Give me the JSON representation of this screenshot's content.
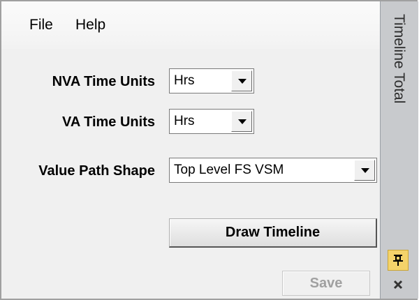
{
  "menu": {
    "file": "File",
    "help": "Help"
  },
  "form": {
    "nva_label": "NVA Time Units",
    "nva_value": "Hrs",
    "va_label": "VA Time Units",
    "va_value": "Hrs",
    "shape_label": "Value Path Shape",
    "shape_value": "Top Level FS VSM"
  },
  "buttons": {
    "draw": "Draw Timeline",
    "save": "Save"
  },
  "side_panel": {
    "title": "Timeline Total"
  },
  "icons": {
    "pin": "pin-icon",
    "close": "close-icon",
    "dropdown": "chevron-down-icon"
  },
  "colors": {
    "side_panel_bg": "#c8cacd",
    "pin_bg": "#f4d36a"
  }
}
